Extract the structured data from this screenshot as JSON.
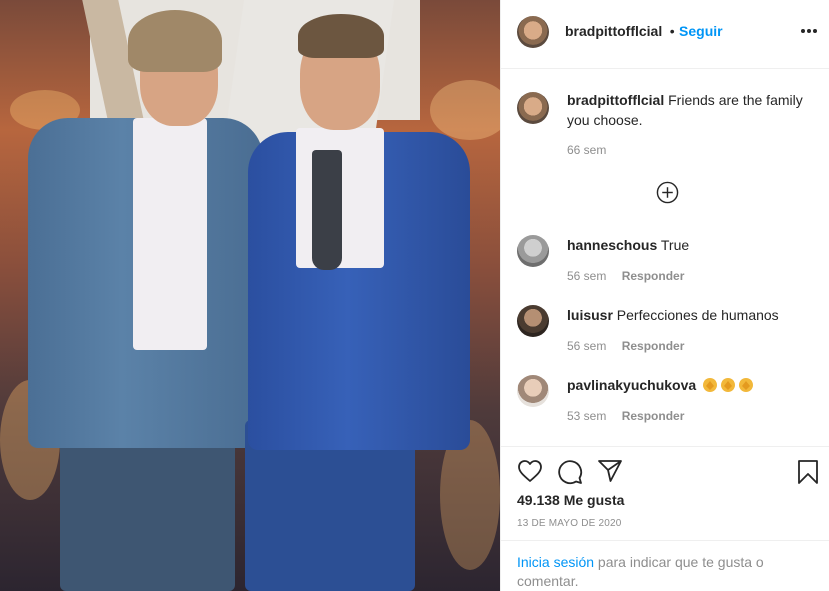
{
  "header": {
    "username": "bradpittofflcial",
    "separator": "•",
    "follow_label": "Seguir"
  },
  "caption": {
    "username": "bradpittofflcial",
    "text": "Friends are the family you choose.",
    "time": "66 sem"
  },
  "comments": [
    {
      "username": "hanneschous",
      "text": "True",
      "time": "56 sem",
      "reply": "Responder"
    },
    {
      "username": "luisusr",
      "text": "Perfecciones de humanos",
      "time": "56 sem",
      "reply": "Responder"
    },
    {
      "username": "pavlinakyuchukova",
      "text": "",
      "emoji": [
        "clapping-hands",
        "clapping-hands",
        "clapping-hands"
      ],
      "time": "53 sem",
      "reply": "Responder"
    }
  ],
  "likes": "49.138 Me gusta",
  "date": "13 DE MAYO DE 2020",
  "login": {
    "link": "Inicia sesión",
    "rest": " para indicar que te gusta o comentar."
  },
  "colors": {
    "accent": "#0095f6",
    "muted": "#8e8e8e",
    "text": "#262626"
  },
  "icons": [
    "more-options-icon",
    "add-comments-icon",
    "like-heart-icon",
    "comment-icon",
    "share-icon",
    "save-bookmark-icon"
  ]
}
